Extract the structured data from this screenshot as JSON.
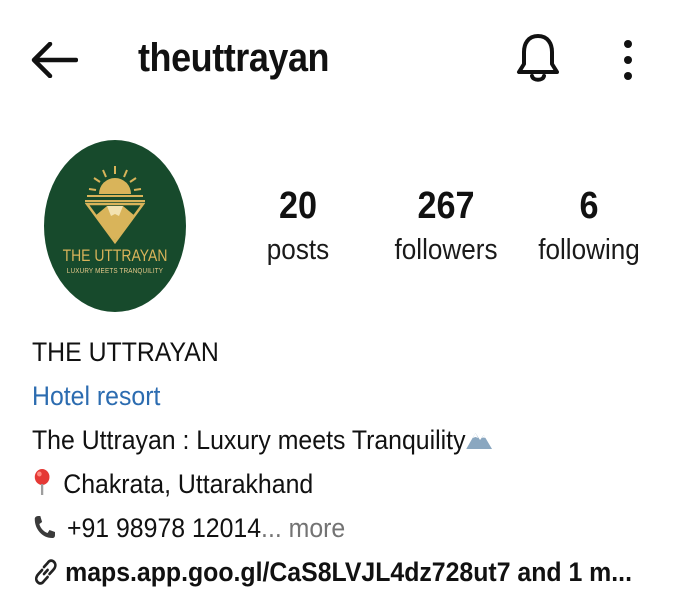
{
  "header": {
    "username": "theuttrayan",
    "back_icon": "arrow-left-icon",
    "bell_icon": "bell-icon",
    "menu_icon": "more-vertical-icon"
  },
  "avatar": {
    "logo_title": "THE UTTRAYAN",
    "logo_subtitle": "LUXURY MEETS TRANQUILITY",
    "bg_color": "#174a2c",
    "accent_color": "#d9b45a"
  },
  "stats": [
    {
      "value": "20",
      "label": "posts"
    },
    {
      "value": "267",
      "label": "followers"
    },
    {
      "value": "6",
      "label": "following"
    }
  ],
  "bio": {
    "display_name": "THE UTTRAYAN",
    "category": "Hotel resort",
    "tagline": "The Uttrayan : Luxury meets Tranquility",
    "location_icon": "pin-icon",
    "location": "Chakrata, Uttarakhand",
    "phone_icon": "phone-icon",
    "phone": "+91 98978 12014",
    "more_label": "... more",
    "link_icon": "link-icon",
    "link": "maps.app.goo.gl/CaS8LVJL4dz728ut7 and 1 m..."
  },
  "colors": {
    "category_blue": "#2c6cb0",
    "muted_gray": "#737373"
  }
}
